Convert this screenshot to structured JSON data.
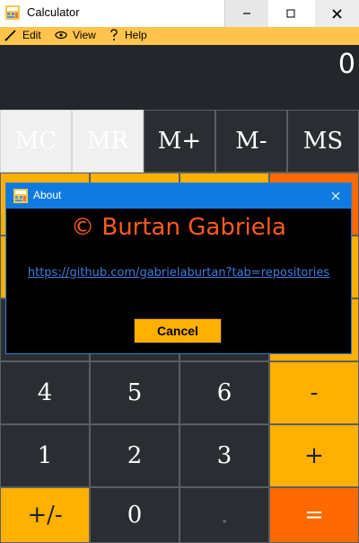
{
  "window": {
    "title": "Calculator",
    "controls": {
      "minimize": "minimize",
      "maximize": "maximize",
      "close": "close"
    }
  },
  "menu": {
    "items": [
      {
        "label": "Edit",
        "icon": "pencil-icon"
      },
      {
        "label": "View",
        "icon": "eye-icon"
      },
      {
        "label": "Help",
        "icon": "question-icon"
      }
    ]
  },
  "display": {
    "value": "0"
  },
  "memory_keys": [
    "MC",
    "MR",
    "M+",
    "M-",
    "MS"
  ],
  "keys": {
    "four": "4",
    "five": "5",
    "six": "6",
    "minus": "-",
    "one": "1",
    "two": "2",
    "three": "3",
    "plus": "+",
    "negate": "+/-",
    "zero": "0",
    "decimal": ".",
    "equals": "="
  },
  "about_dialog": {
    "title": "About",
    "copyright": "© Burtan Gabriela",
    "link": "https://github.com/gabrielaburtan?tab=repositories",
    "cancel_label": "Cancel"
  },
  "colors": {
    "accent_orange": "#ffb000",
    "accent_red": "#ff6a00",
    "menubar": "#ffc44d",
    "dialog_title": "#0f7be0",
    "copyright_text": "#ff5a1f"
  }
}
